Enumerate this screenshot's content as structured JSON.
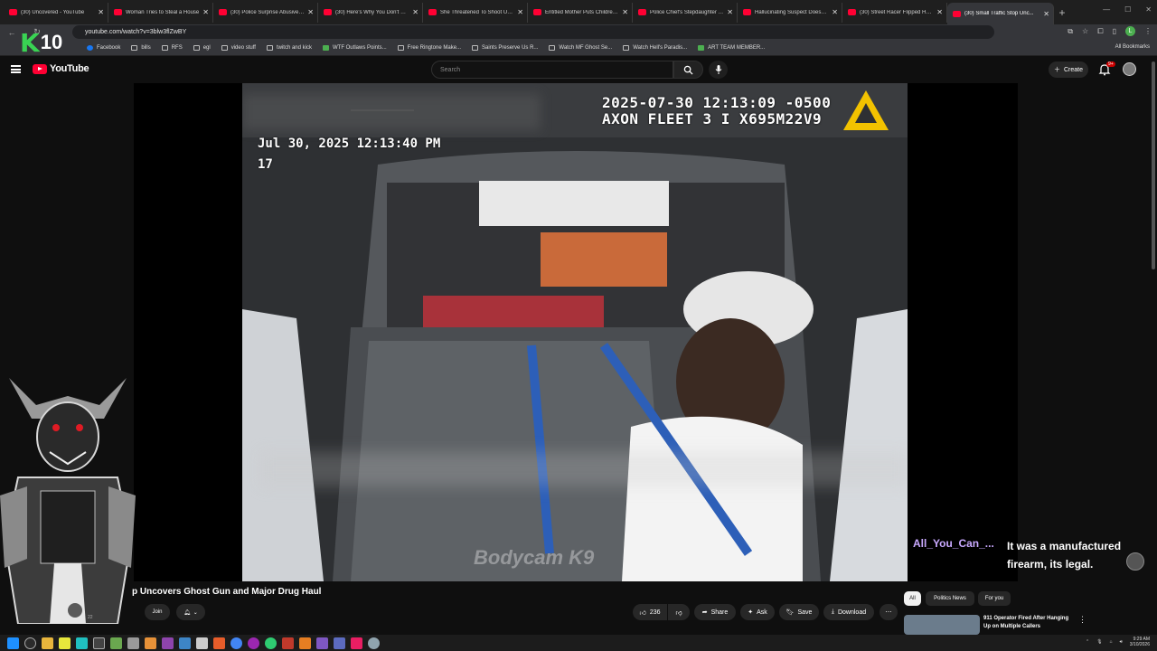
{
  "browser": {
    "tabs": [
      {
        "label": "(30) Uncovered - YouTube"
      },
      {
        "label": "Woman Tries to Steal a House"
      },
      {
        "label": "(30) Police Surprise Abusive G..."
      },
      {
        "label": "(30) Here's Why You Don't He..."
      },
      {
        "label": "She Threatened To Shoot Up S..."
      },
      {
        "label": "Entitled Mother Puts Children..."
      },
      {
        "label": "Police Chief's Stepdaughter A..."
      },
      {
        "label": "Hallucinating Suspect Doesn't..."
      },
      {
        "label": "(30) Street Racer Flipped Her C..."
      },
      {
        "label": "(30) Small Traffic Stop Unc..."
      }
    ],
    "url": "youtube.com/watch?v=3blw3flZwBY",
    "bookmarks": [
      "Facebook",
      "bills",
      "RFS",
      "egl",
      "video stuff",
      "twitch and kick",
      "WTF Outlaws Points...",
      "Free Ringtone Make...",
      "Saints Preserve Us R...",
      "Watch MF Ghost Se...",
      "Watch Hell's Paradis...",
      "ART TEAM MEMBER..."
    ],
    "all_bookmarks": "All Bookmarks"
  },
  "overlay_badge": {
    "letter": "K",
    "number": "10"
  },
  "youtube": {
    "logo": "YouTube",
    "search_placeholder": "Search",
    "create_label": "Create",
    "notif_count": "9+"
  },
  "video": {
    "stamp_line1": "2025-07-30 12:13:09 -0500",
    "stamp_line2": "AXON FLEET 3 I X695M22V9",
    "date_overlay": "Jul 30, 2025 12:13:40 PM",
    "unit_overlay": "17",
    "watermark": "Bodycam K9",
    "title": "p Uncovers Ghost Gun and Major Drug Haul"
  },
  "chat": {
    "user": "All_You_Can_...",
    "message": "It was a manufactured firearm, its legal."
  },
  "actions": {
    "join": "Join",
    "likes": "236",
    "share": "Share",
    "ask": "Ask",
    "save": "Save",
    "download": "Download",
    "channel_sub": "22"
  },
  "chips": [
    "All",
    "Politics News",
    "For you"
  ],
  "related": {
    "title": "911 Operator Fired After Hanging Up on Multiple Callers"
  },
  "taskbar": {
    "time": "9:29 AM",
    "date": "3/10/2026"
  },
  "colors": {
    "brand_red": "#ff0033",
    "accent_green": "#39d353",
    "chat_name": "#c9a9ff",
    "background": "#0f0f0f"
  }
}
